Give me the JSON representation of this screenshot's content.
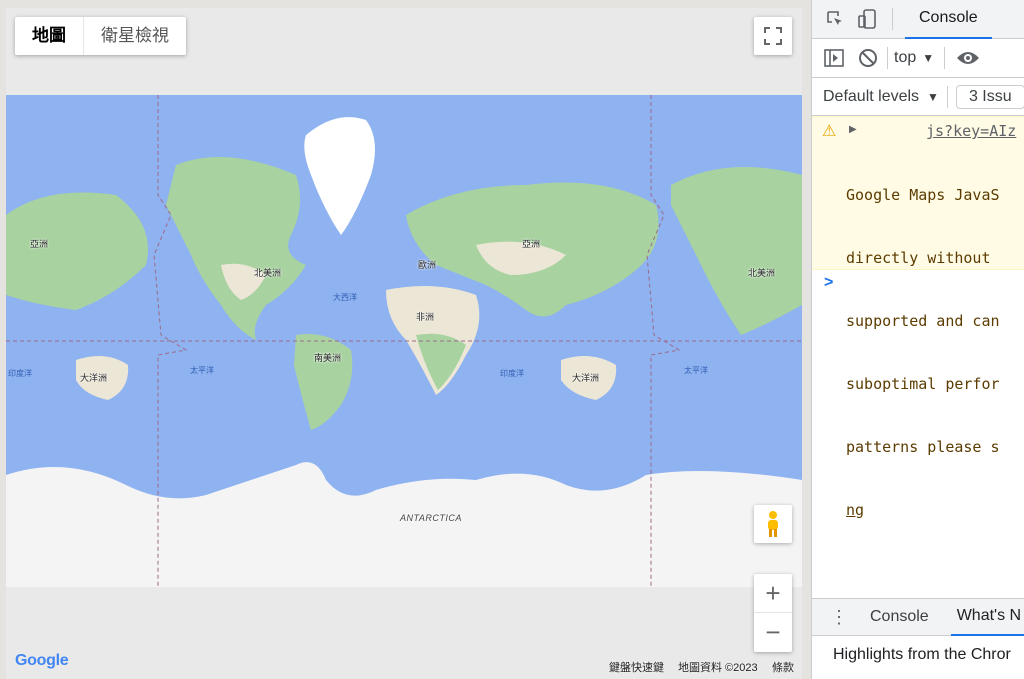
{
  "map": {
    "map_types": [
      "地圖",
      "衛星檢視"
    ],
    "continents": {
      "asia": "亞洲",
      "europe": "歐洲",
      "africa": "非洲",
      "north_america": "北美洲",
      "south_america": "南美洲",
      "oceania": "大洋洲",
      "antarctica": "ANTARCTICA"
    },
    "oceans": {
      "atlantic": "大西洋",
      "pacific": "太平洋",
      "indian": "印度洋"
    },
    "footer": {
      "shortcuts": "鍵盤快速鍵",
      "attribution": "地圖資料 ©2023",
      "terms": "條款",
      "logo": "Google"
    },
    "zoom_in": "+",
    "zoom_out": "−",
    "colors": {
      "water": "#8fb2f0",
      "land": "#a8d3a0",
      "ice": "#f5f5f5",
      "desert": "#ece6d6"
    }
  },
  "devtools": {
    "tabs": [
      "Console",
      "What's N"
    ],
    "console_tab": "Console",
    "context": "top",
    "levels": "Default levels",
    "issues": "3 Issu",
    "message": {
      "link": "js?key=AIz",
      "lines": [
        "Google Maps JavaS",
        "directly without",
        "supported and can",
        "suboptimal perfor",
        "patterns please s",
        "ng"
      ]
    },
    "prompt": ">",
    "drawer_tabs": [
      "Console",
      "What's N"
    ],
    "drawer_text": "Highlights from the Chror"
  }
}
